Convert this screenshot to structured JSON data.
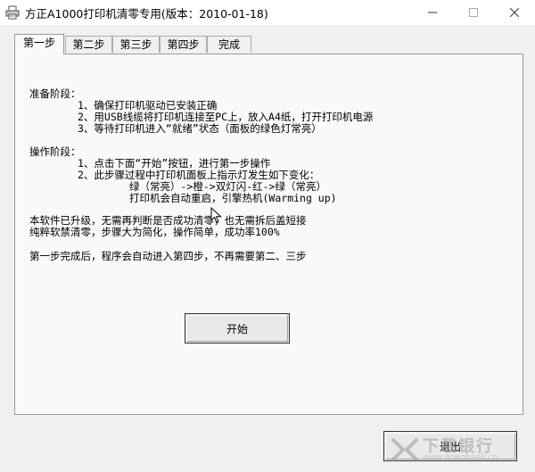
{
  "window": {
    "title": "方正A1000打印机清零专用(版本：2010-01-18)",
    "minimize_icon": "minimize-icon",
    "maximize_icon": "maximize-icon",
    "close_icon": "close-icon"
  },
  "tabs": [
    {
      "label": "第一步",
      "active": true
    },
    {
      "label": "第二步",
      "active": false
    },
    {
      "label": "第三步",
      "active": false
    },
    {
      "label": "第四步",
      "active": false
    },
    {
      "label": "完成",
      "active": false
    }
  ],
  "content": {
    "prep_heading": "准备阶段：",
    "prep_items": [
      "1、确保打印机驱动已安装正确",
      "2、用USB线缆将打印机连接至PC上，放入A4纸，打开打印机电源",
      "3、等待打印机进入“就绪”状态（面板的绿色灯常亮）"
    ],
    "op_heading": "操作阶段：",
    "op_items": [
      "1、点击下面“开始”按钮，进行第一步操作",
      "2、此步骤过程中打印机面板上指示灯发生如下变化："
    ],
    "op_sub": [
      "绿（常亮）->橙->双灯闪-红->绿（常亮）",
      "打印机会自动重启，引擎热机(Warming up)"
    ],
    "notes": [
      "本软件已升级，无需再判断是否成功清零，也无需拆后盖短接",
      "纯粹软禁清零，步骤大为简化，操作简单，成功率100%"
    ],
    "final_note": "第一步完成后，程序会自动进入第四步，不再需要第二、三步"
  },
  "buttons": {
    "start_label": "开始",
    "exit_label": "退出"
  },
  "watermark": {
    "text": "下载银行",
    "sub": "www.downbank.cn"
  }
}
